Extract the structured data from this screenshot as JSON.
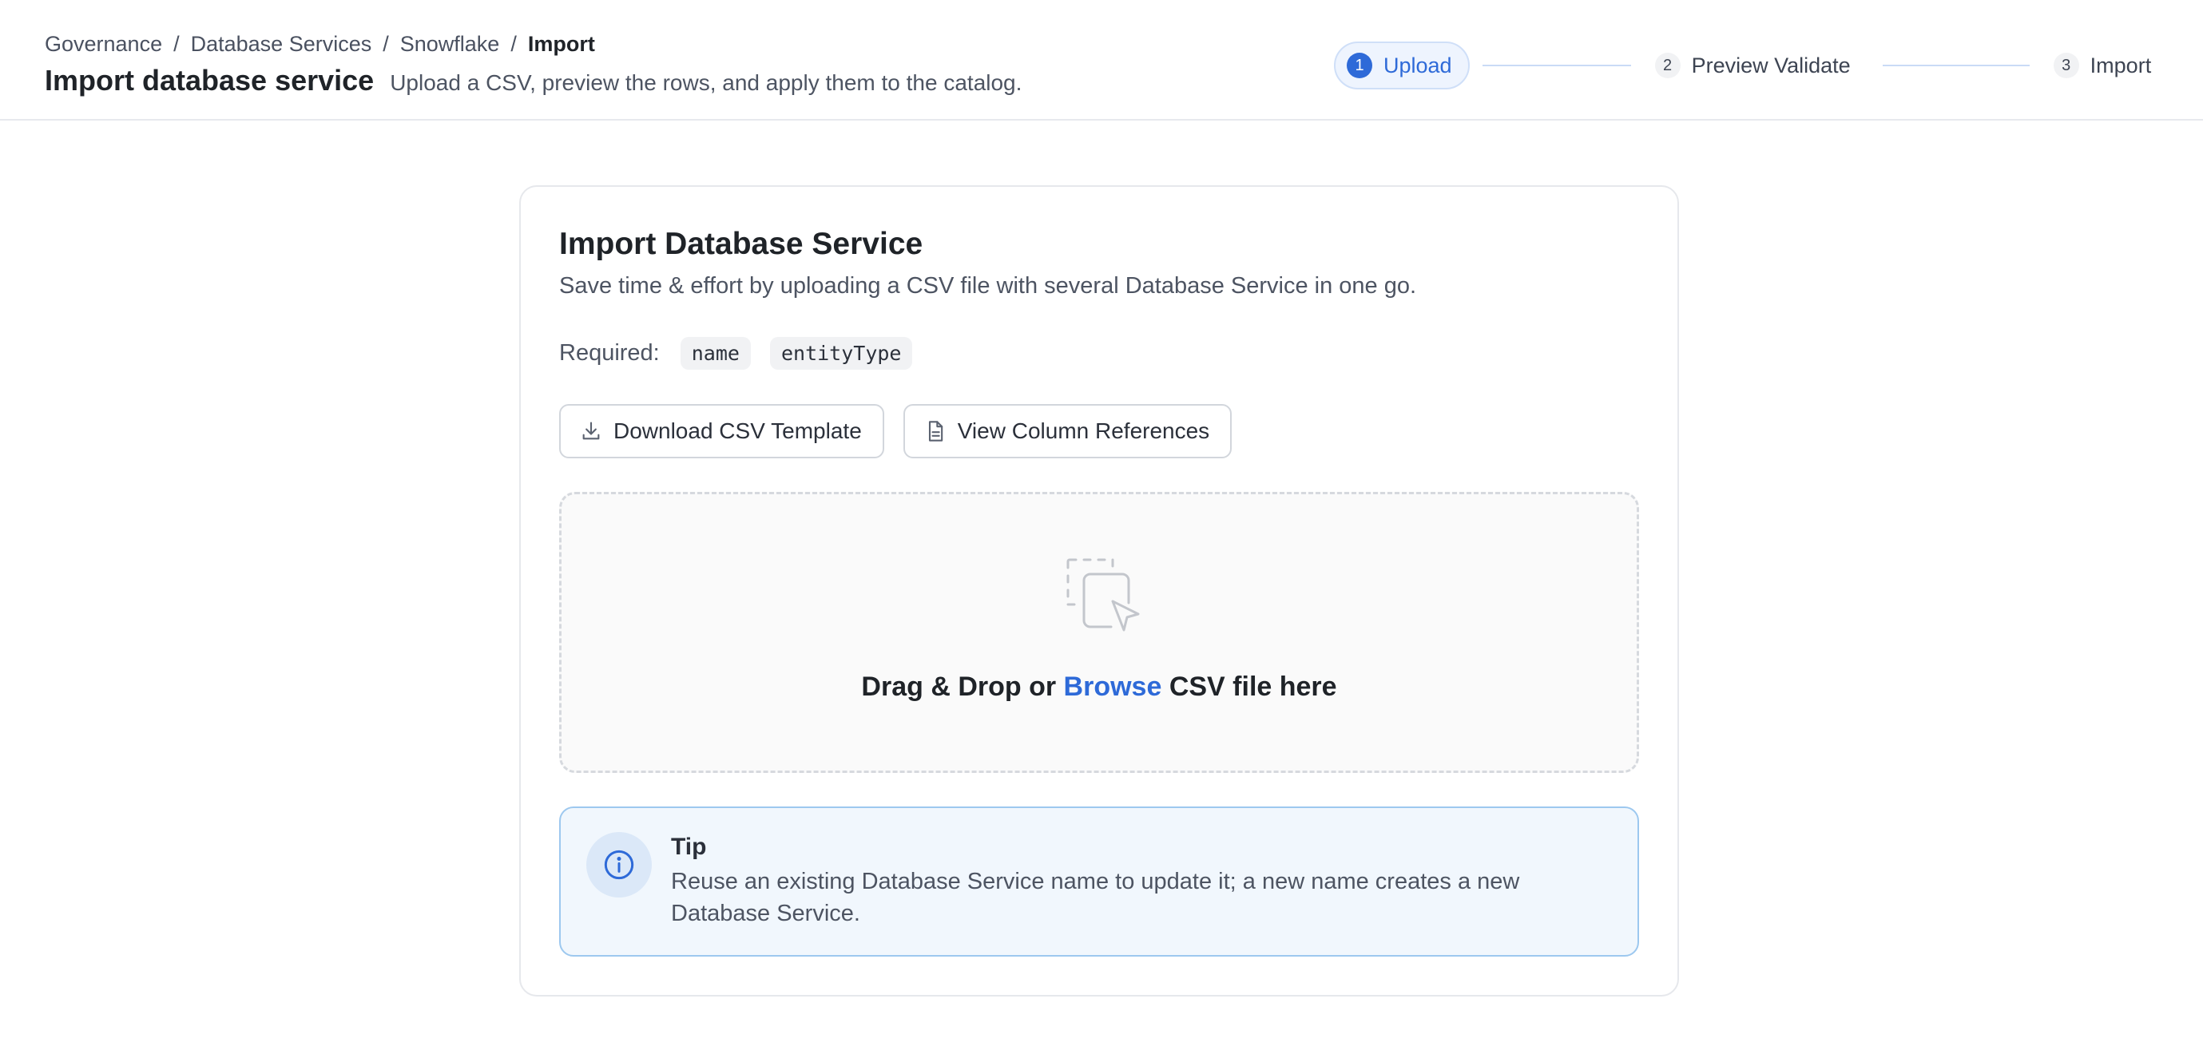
{
  "breadcrumb": {
    "items": [
      "Governance",
      "Database Services",
      "Snowflake"
    ],
    "current": "Import",
    "separator": "/"
  },
  "page": {
    "title": "Import database service",
    "subtitle": "Upload a CSV, preview the rows, and apply them to the catalog."
  },
  "stepper": {
    "steps": [
      {
        "number": "1",
        "label": "Upload",
        "active": true
      },
      {
        "number": "2",
        "label": "Preview Validate",
        "active": false
      },
      {
        "number": "3",
        "label": "Import",
        "active": false
      }
    ]
  },
  "card": {
    "title": "Import Database Service",
    "description": "Save time & effort by uploading a CSV file with several Database Service in one go.",
    "required_label": "Required:",
    "required_fields": [
      "name",
      "entityType"
    ],
    "buttons": {
      "download_template": "Download CSV Template",
      "view_references": "View Column References"
    },
    "dropzone": {
      "prefix": "Drag & Drop or",
      "link": "Browse",
      "suffix": "CSV file here"
    },
    "tip": {
      "title": "Tip",
      "body": "Reuse an existing Database Service name to update it; a new name creates a new Database Service."
    }
  },
  "icons": {
    "download": "download-icon",
    "document": "document-icon",
    "upload_dropzone": "drag-drop-icon",
    "info": "info-icon"
  },
  "colors": {
    "accent": "#2e6ad8",
    "tip_border": "#9dc8ef",
    "tip_background": "#f1f7fd",
    "stepper_active_bg": "#eef4fe"
  }
}
